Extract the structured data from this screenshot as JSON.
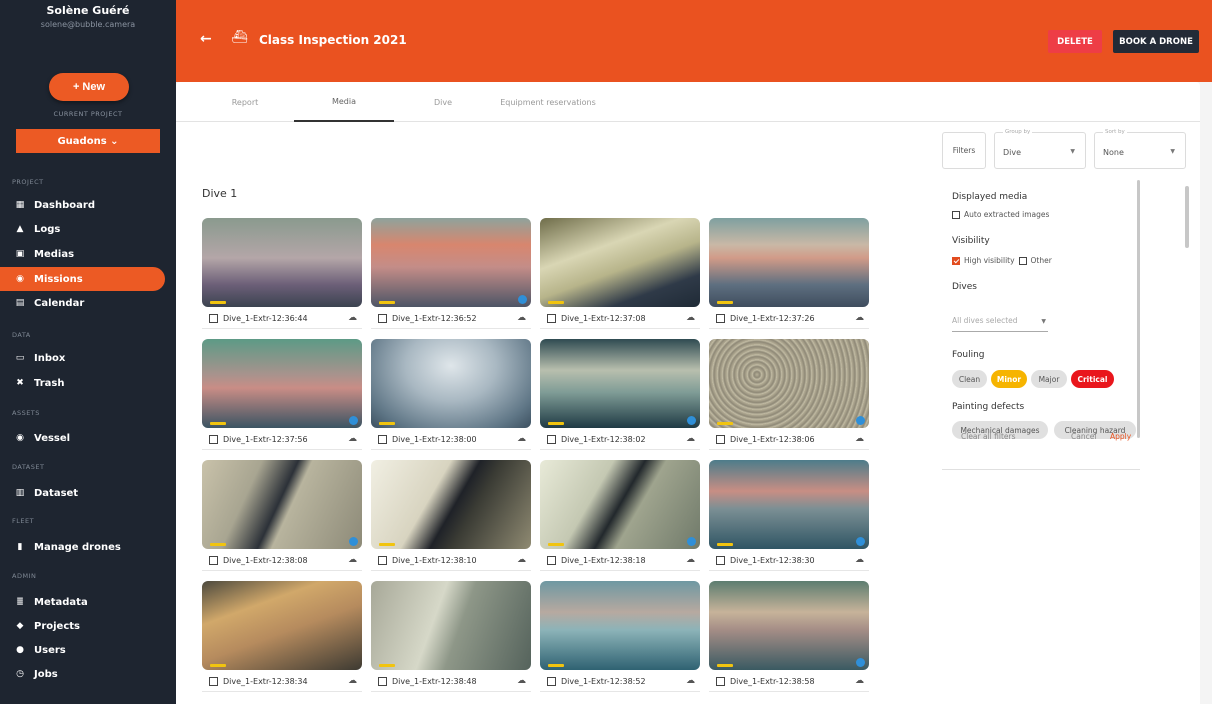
{
  "user": {
    "name": "Solène Guéré",
    "email": "solene@bubble.camera"
  },
  "sidebar": {
    "new_label": "+ New",
    "current_project_label": "CURRENT PROJECT",
    "project": "Guadons ⌄",
    "sections": {
      "project": "PROJECT",
      "data": "DATA",
      "assets": "ASSETS",
      "dataset": "DATASET",
      "fleet": "FLEET",
      "admin": "ADMIN"
    },
    "items": {
      "dashboard": "Dashboard",
      "logs": "Logs",
      "medias": "Medias",
      "missions": "Missions",
      "calendar": "Calendar",
      "inbox": "Inbox",
      "trash": "Trash",
      "vessel": "Vessel",
      "dataset": "Dataset",
      "manage_drones": "Manage drones",
      "metadata": "Metadata",
      "projects": "Projects",
      "users": "Users",
      "jobs": "Jobs"
    },
    "icons": {
      "dashboard": "▦",
      "logs": "▲",
      "medias": "▣",
      "missions": "◉",
      "calendar": "▤",
      "inbox": "▭",
      "trash": "✖",
      "vessel": "◉",
      "dataset": "▥",
      "manage_drones": "▮",
      "metadata": "≣",
      "projects": "◆",
      "users": "●",
      "jobs": "◷"
    }
  },
  "header": {
    "back_icon": "←",
    "title_icon": "⛴",
    "title": "Class Inspection 2021",
    "delete_label": "DELETE",
    "book_label": "BOOK A DRONE"
  },
  "tabs": [
    "Report",
    "Media",
    "Dive",
    "Equipment reservations"
  ],
  "active_tab": "Media",
  "gallery": {
    "heading": "Dive 1",
    "items": [
      "Dive_1-Extr-12:36:44",
      "Dive_1-Extr-12:36:52",
      "Dive_1-Extr-12:37:08",
      "Dive_1-Extr-12:37:26",
      "Dive_1-Extr-12:37:56",
      "Dive_1-Extr-12:38:00",
      "Dive_1-Extr-12:38:02",
      "Dive_1-Extr-12:38:06",
      "Dive_1-Extr-12:38:08",
      "Dive_1-Extr-12:38:10",
      "Dive_1-Extr-12:38:18",
      "Dive_1-Extr-12:38:30",
      "Dive_1-Extr-12:38:34",
      "Dive_1-Extr-12:38:48",
      "Dive_1-Extr-12:38:52",
      "Dive_1-Extr-12:38:58"
    ],
    "cloud_icon": "☁"
  },
  "filters": {
    "button_label": "Filters",
    "group_by_label": "Group by",
    "group_by_value": "Dive",
    "sort_by_label": "Sort by",
    "sort_by_value": "None",
    "caret": "▼",
    "displayed_media_title": "Displayed media",
    "auto_extracted": "Auto extracted images",
    "visibility_title": "Visibility",
    "high_visibility": "High visibility",
    "other": "Other",
    "dives_title": "Dives",
    "dives_placeholder": "All dives selected",
    "fouling_title": "Fouling",
    "fouling": {
      "clean": "Clean",
      "minor": "Minor",
      "major": "Major",
      "critical": "Critical"
    },
    "painting_title": "Painting defects",
    "painting": {
      "mechanical": "Mechanical damages",
      "cleaning": "Cleaning hazard"
    },
    "clear_all": "Clear all filters",
    "cancel": "Cancel",
    "apply": "Apply"
  }
}
